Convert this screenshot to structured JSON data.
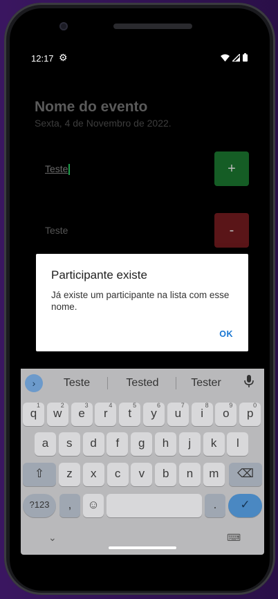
{
  "status_bar": {
    "time": "12:17",
    "gear_icon": "⚙"
  },
  "event": {
    "title": "Nome do evento",
    "date": "Sexta, 4 de Novembro de 2022."
  },
  "participants": [
    {
      "name": "Teste",
      "button": "+"
    },
    {
      "name": "Teste",
      "button": "-"
    }
  ],
  "dialog": {
    "title": "Participante existe",
    "message": "Já existe um participante na lista com esse nome.",
    "ok_label": "OK"
  },
  "keyboard": {
    "suggestions": [
      "Teste",
      "Tested",
      "Tester"
    ],
    "row1": [
      {
        "label": "q",
        "sup": "1"
      },
      {
        "label": "w",
        "sup": "2"
      },
      {
        "label": "e",
        "sup": "3"
      },
      {
        "label": "r",
        "sup": "4"
      },
      {
        "label": "t",
        "sup": "5"
      },
      {
        "label": "y",
        "sup": "6"
      },
      {
        "label": "u",
        "sup": "7"
      },
      {
        "label": "i",
        "sup": "8"
      },
      {
        "label": "o",
        "sup": "9"
      },
      {
        "label": "p",
        "sup": "0"
      }
    ],
    "row2": [
      "a",
      "s",
      "d",
      "f",
      "g",
      "h",
      "j",
      "k",
      "l"
    ],
    "row3": [
      "z",
      "x",
      "c",
      "v",
      "b",
      "n",
      "m"
    ],
    "symbols_label": "?123",
    "comma_label": ",",
    "period_label": ".",
    "emoji_icon": "☺",
    "shift_icon": "⇧",
    "backspace_icon": "⌫",
    "enter_icon": "✓",
    "mic_icon": "🎤",
    "expand_icon": "›",
    "hide_icon": "⌄",
    "switcher_icon": "⌨"
  }
}
